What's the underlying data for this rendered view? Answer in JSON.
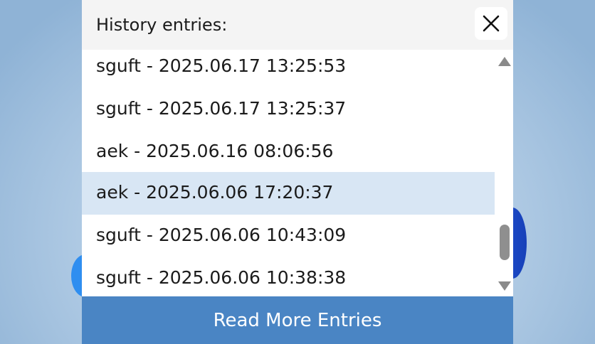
{
  "header": {
    "title": "History entries:",
    "close_icon": "close-icon"
  },
  "history": {
    "entries": [
      {
        "label": "sguft - 2025.06.17 13:25:53",
        "selected": false
      },
      {
        "label": "sguft - 2025.06.17 13:25:37",
        "selected": false
      },
      {
        "label": "aek - 2025.06.16 08:06:56",
        "selected": false
      },
      {
        "label": "aek - 2025.06.06 17:20:37",
        "selected": true
      },
      {
        "label": "sguft - 2025.06.06 10:43:09",
        "selected": false
      },
      {
        "label": "sguft - 2025.06.06 10:38:38",
        "selected": false
      }
    ]
  },
  "footer": {
    "button_label": "Read More Entries"
  },
  "colors": {
    "accent": "#4a85c4",
    "selected_row": "#d8e6f4",
    "header_bg": "#f4f4f4"
  }
}
